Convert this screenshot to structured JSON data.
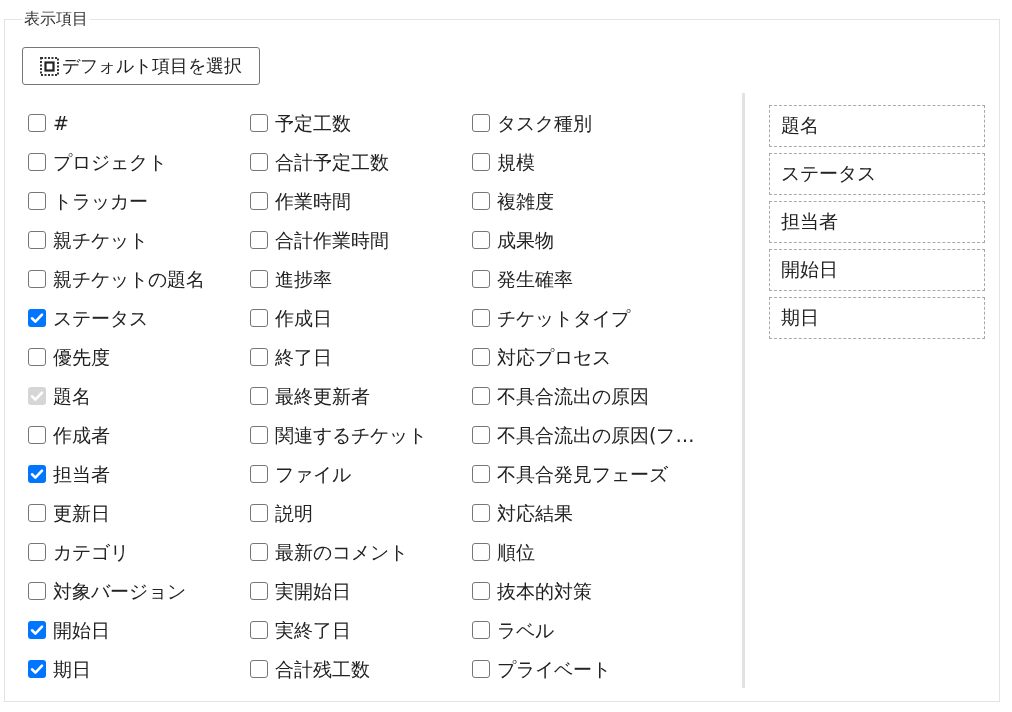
{
  "fieldset": {
    "legend": "表示項目",
    "default_button": {
      "label": "デフォルト項目を選択"
    },
    "columns": [
      {
        "items": [
          {
            "label": "#",
            "checked": false,
            "disabled": false
          },
          {
            "label": "プロジェクト",
            "checked": false,
            "disabled": false
          },
          {
            "label": "トラッカー",
            "checked": false,
            "disabled": false
          },
          {
            "label": "親チケット",
            "checked": false,
            "disabled": false
          },
          {
            "label": "親チケットの題名",
            "checked": false,
            "disabled": false
          },
          {
            "label": "ステータス",
            "checked": true,
            "disabled": false
          },
          {
            "label": "優先度",
            "checked": false,
            "disabled": false
          },
          {
            "label": "題名",
            "checked": true,
            "disabled": true
          },
          {
            "label": "作成者",
            "checked": false,
            "disabled": false
          },
          {
            "label": "担当者",
            "checked": true,
            "disabled": false
          },
          {
            "label": "更新日",
            "checked": false,
            "disabled": false
          },
          {
            "label": "カテゴリ",
            "checked": false,
            "disabled": false
          },
          {
            "label": "対象バージョン",
            "checked": false,
            "disabled": false
          },
          {
            "label": "開始日",
            "checked": true,
            "disabled": false
          },
          {
            "label": "期日",
            "checked": true,
            "disabled": false
          }
        ]
      },
      {
        "items": [
          {
            "label": "予定工数",
            "checked": false,
            "disabled": false
          },
          {
            "label": "合計予定工数",
            "checked": false,
            "disabled": false
          },
          {
            "label": "作業時間",
            "checked": false,
            "disabled": false
          },
          {
            "label": "合計作業時間",
            "checked": false,
            "disabled": false
          },
          {
            "label": "進捗率",
            "checked": false,
            "disabled": false
          },
          {
            "label": "作成日",
            "checked": false,
            "disabled": false
          },
          {
            "label": "終了日",
            "checked": false,
            "disabled": false
          },
          {
            "label": "最終更新者",
            "checked": false,
            "disabled": false
          },
          {
            "label": "関連するチケット",
            "checked": false,
            "disabled": false
          },
          {
            "label": "ファイル",
            "checked": false,
            "disabled": false
          },
          {
            "label": "説明",
            "checked": false,
            "disabled": false
          },
          {
            "label": "最新のコメント",
            "checked": false,
            "disabled": false
          },
          {
            "label": "実開始日",
            "checked": false,
            "disabled": false
          },
          {
            "label": "実終了日",
            "checked": false,
            "disabled": false
          },
          {
            "label": "合計残工数",
            "checked": false,
            "disabled": false
          }
        ]
      },
      {
        "items": [
          {
            "label": "タスク種別",
            "checked": false,
            "disabled": false
          },
          {
            "label": "規模",
            "checked": false,
            "disabled": false
          },
          {
            "label": "複雑度",
            "checked": false,
            "disabled": false
          },
          {
            "label": "成果物",
            "checked": false,
            "disabled": false
          },
          {
            "label": "発生確率",
            "checked": false,
            "disabled": false
          },
          {
            "label": "チケットタイプ",
            "checked": false,
            "disabled": false
          },
          {
            "label": "対応プロセス",
            "checked": false,
            "disabled": false
          },
          {
            "label": "不具合流出の原因",
            "checked": false,
            "disabled": false
          },
          {
            "label": "不具合流出の原因(フ…",
            "checked": false,
            "disabled": false
          },
          {
            "label": "不具合発見フェーズ",
            "checked": false,
            "disabled": false
          },
          {
            "label": "対応結果",
            "checked": false,
            "disabled": false
          },
          {
            "label": "順位",
            "checked": false,
            "disabled": false
          },
          {
            "label": "抜本的対策",
            "checked": false,
            "disabled": false
          },
          {
            "label": "ラベル",
            "checked": false,
            "disabled": false
          },
          {
            "label": "プライベート",
            "checked": false,
            "disabled": false
          }
        ]
      }
    ],
    "selected_columns": [
      {
        "label": "題名"
      },
      {
        "label": "ステータス"
      },
      {
        "label": "担当者"
      },
      {
        "label": "開始日"
      },
      {
        "label": "期日"
      }
    ]
  }
}
